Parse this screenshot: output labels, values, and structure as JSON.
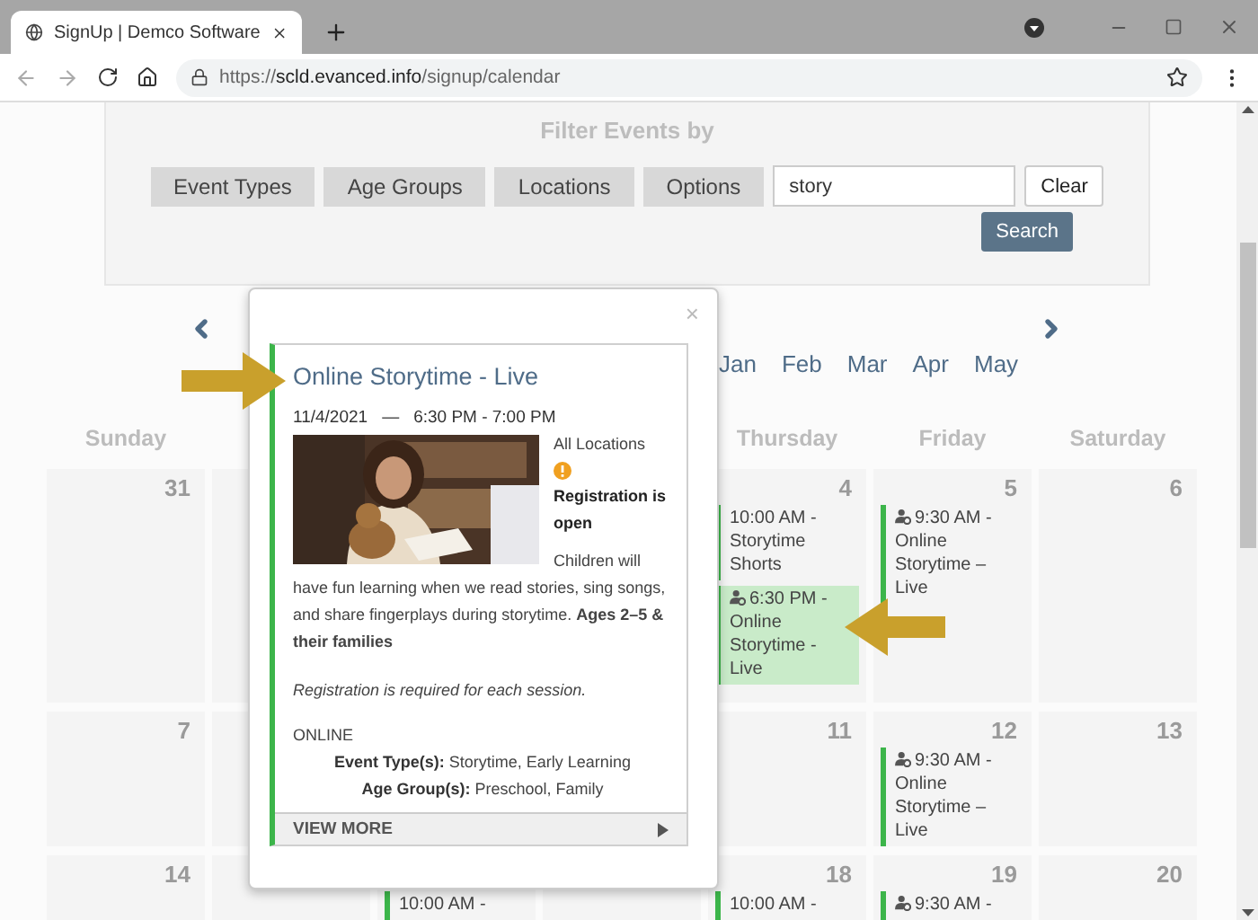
{
  "browser": {
    "tab_title": "SignUp | Demco Software",
    "url": {
      "scheme": "https://",
      "host": "scld.evanced.info",
      "path": "/signup/calendar"
    }
  },
  "filter": {
    "heading": "Filter Events by",
    "buttons": [
      "Event Types",
      "Age Groups",
      "Locations",
      "Options"
    ],
    "search": {
      "value": "story"
    },
    "clear": "Clear",
    "submit": "Search"
  },
  "month_nav": {
    "months": [
      "Jan",
      "Feb",
      "Mar",
      "Apr",
      "May"
    ]
  },
  "weekdays": {
    "sunday": "Sunday",
    "thursday": "Thursday",
    "friday": "Friday",
    "saturday": "Saturday"
  },
  "weeks": [
    {
      "sunday": {
        "day": "31"
      },
      "thursday": {
        "day": "4",
        "events": [
          {
            "kind": "plain",
            "text": "10:00 AM - Storytime Shorts",
            "selected": false
          },
          {
            "kind": "virtual",
            "text": "6:30 PM - Online Storytime - Live",
            "selected": true
          }
        ]
      },
      "friday": {
        "day": "5",
        "events": [
          {
            "kind": "virtual",
            "text": "9:30 AM - Online Storytime – Live",
            "selected": false
          }
        ]
      },
      "saturday": {
        "day": "6"
      }
    },
    {
      "sunday": {
        "day": "7"
      },
      "thursday": {
        "day": "11"
      },
      "friday": {
        "day": "12",
        "events": [
          {
            "kind": "virtual",
            "text": "9:30 AM - Online Storytime – Live",
            "selected": false
          }
        ]
      },
      "saturday": {
        "day": "13"
      }
    },
    {
      "sunday": {
        "day": "14"
      },
      "tuesday": {
        "events": [
          {
            "kind": "plain",
            "text": "10:00 AM -",
            "selected": false
          }
        ]
      },
      "thursday": {
        "day": "18",
        "events": [
          {
            "kind": "plain",
            "text": "10:00 AM -",
            "selected": false
          }
        ]
      },
      "friday": {
        "day": "19",
        "events": [
          {
            "kind": "virtual",
            "text": "9:30 AM -",
            "selected": false
          }
        ]
      },
      "saturday": {
        "day": "20"
      }
    }
  ],
  "popup": {
    "close": "×",
    "title": "Online Storytime - Live",
    "date": "11/4/2021",
    "dash": "—",
    "time": "6:30 PM - 7:00 PM",
    "location": "All Locations",
    "registration": "Registration is open",
    "description": "Children will have fun learning when we read stories, sing songs, and share fingerplays during storytime. **Ages 2–5 & their families**",
    "note": "Registration is required for each session.",
    "venue": "ONLINE",
    "details": [
      {
        "label": "Event Type(s):",
        "value": "Storytime, Early Learning"
      },
      {
        "label": "Age Group(s):",
        "value": "Preschool, Family"
      }
    ],
    "view_more": "VIEW MORE"
  }
}
